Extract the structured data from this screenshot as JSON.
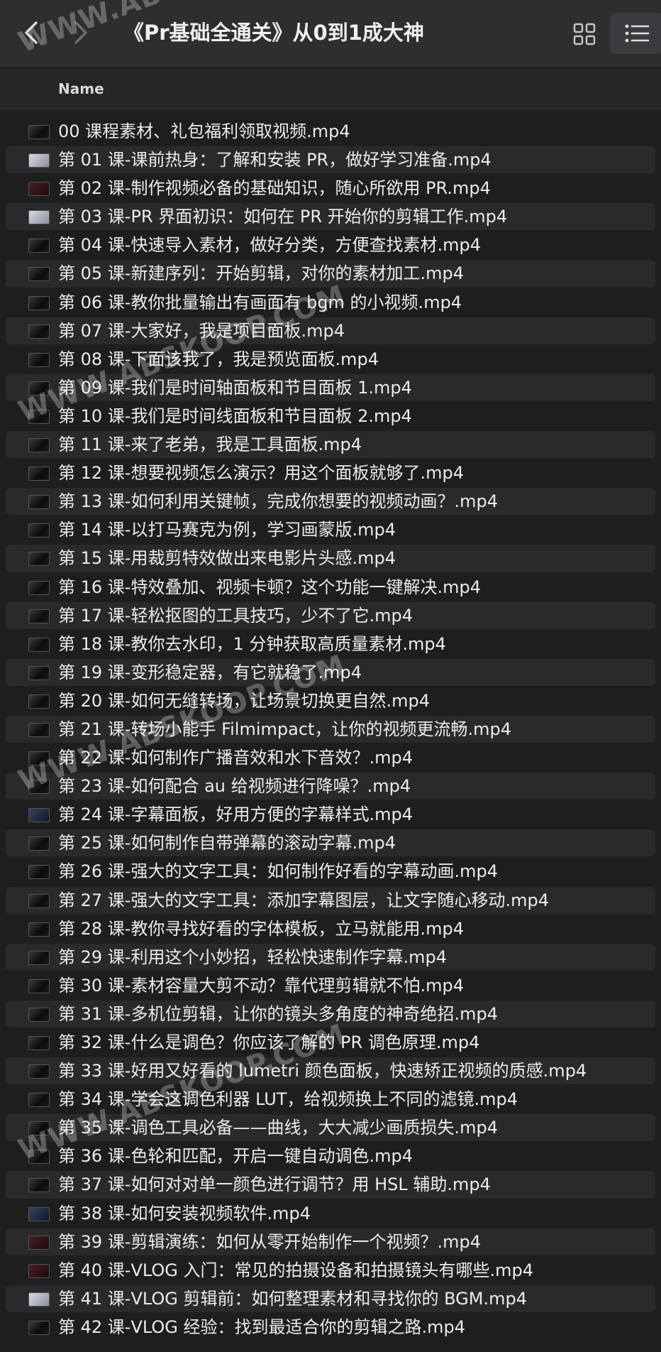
{
  "toolbar": {
    "title": "《Pr基础全通关》从0到1成大神",
    "back_icon": "chevron-left-icon",
    "forward_icon": "chevron-right-icon",
    "grid_view_icon": "grid-view-icon",
    "list_view_icon": "list-view-icon"
  },
  "column_header": {
    "name_label": "Name"
  },
  "watermark": {
    "text": "WWW.ABSKOOP.COM"
  },
  "files": [
    {
      "name": "00 课程素材、礼包福利领取视频.mp4",
      "thumb": "video"
    },
    {
      "name": "第 01 课-课前热身：了解和安装 PR，做好学习准备.mp4",
      "thumb": "light"
    },
    {
      "name": "第 02 课-制作视频必备的基础知识，随心所欲用 PR.mp4",
      "thumb": "red"
    },
    {
      "name": "第 03 课-PR 界面初识：如何在 PR 开始你的剪辑工作.mp4",
      "thumb": "light"
    },
    {
      "name": "第 04 课-快速导入素材，做好分类，方便查找素材.mp4",
      "thumb": "video"
    },
    {
      "name": "第 05 课-新建序列：开始剪辑，对你的素材加工.mp4",
      "thumb": "video"
    },
    {
      "name": "第 06 课-教你批量输出有画面有 bgm 的小视频.mp4",
      "thumb": "video"
    },
    {
      "name": "第 07 课-大家好，我是项目面板.mp4",
      "thumb": "video"
    },
    {
      "name": "第 08 课-下面该我了，我是预览面板.mp4",
      "thumb": "video"
    },
    {
      "name": "第 09 课-我们是时间轴面板和节目面板 1.mp4",
      "thumb": "video"
    },
    {
      "name": "第 10 课-我们是时间线面板和节目面板 2.mp4",
      "thumb": "video"
    },
    {
      "name": "第 11 课-来了老弟，我是工具面板.mp4",
      "thumb": "video"
    },
    {
      "name": "第 12 课-想要视频怎么演示？用这个面板就够了.mp4",
      "thumb": "video"
    },
    {
      "name": "第 13 课-如何利用关键帧，完成你想要的视频动画？.mp4",
      "thumb": "video"
    },
    {
      "name": "第 14 课-以打马赛克为例，学习画蒙版.mp4",
      "thumb": "video"
    },
    {
      "name": "第 15 课-用裁剪特效做出来电影片头感.mp4",
      "thumb": "video"
    },
    {
      "name": "第 16 课-特效叠加、视频卡顿？这个功能一键解决.mp4",
      "thumb": "video"
    },
    {
      "name": "第 17 课-轻松抠图的工具技巧，少不了它.mp4",
      "thumb": "video"
    },
    {
      "name": "第 18 课-教你去水印，1 分钟获取高质量素材.mp4",
      "thumb": "video"
    },
    {
      "name": "第 19 课-变形稳定器，有它就稳了.mp4",
      "thumb": "video"
    },
    {
      "name": "第 20 课-如何无缝转场，让场景切换更自然.mp4",
      "thumb": "video"
    },
    {
      "name": "第 21 课-转场小能手 Filmimpact，让你的视频更流畅.mp4",
      "thumb": "video"
    },
    {
      "name": "第 22 课-如何制作广播音效和水下音效？.mp4",
      "thumb": "video"
    },
    {
      "name": "第 23 课-如何配合 au 给视频进行降噪？.mp4",
      "thumb": "video"
    },
    {
      "name": "第 24 课-字幕面板，好用方便的字幕样式.mp4",
      "thumb": "blue"
    },
    {
      "name": "第 25 课-如何制作自带弹幕的滚动字幕.mp4",
      "thumb": "video"
    },
    {
      "name": "第 26 课-强大的文字工具：如何制作好看的字幕动画.mp4",
      "thumb": "video"
    },
    {
      "name": "第 27 课-强大的文字工具：添加字幕图层，让文字随心移动.mp4",
      "thumb": "video"
    },
    {
      "name": "第 28 课-教你寻找好看的字体模板，立马就能用.mp4",
      "thumb": "video"
    },
    {
      "name": "第 29 课-利用这个小妙招，轻松快速制作字幕.mp4",
      "thumb": "video"
    },
    {
      "name": "第 30 课-素材容量大剪不动？靠代理剪辑就不怕.mp4",
      "thumb": "video"
    },
    {
      "name": "第 31 课-多机位剪辑，让你的镜头多角度的神奇绝招.mp4",
      "thumb": "video"
    },
    {
      "name": "第 32 课-什么是调色？你应该了解的 PR 调色原理.mp4",
      "thumb": "video"
    },
    {
      "name": "第 33 课-好用又好看的 lumetri 颜色面板，快速矫正视频的质感.mp4",
      "thumb": "video"
    },
    {
      "name": "第 34 课-学会这调色利器 LUT，给视频换上不同的滤镜.mp4",
      "thumb": "video"
    },
    {
      "name": "第 35 课-调色工具必备——曲线，大大减少画质损失.mp4",
      "thumb": "video"
    },
    {
      "name": "第 36 课-色轮和匹配，开启一键自动调色.mp4",
      "thumb": "video"
    },
    {
      "name": "第 37 课-如何对对单一颜色进行调节？用 HSL 辅助.mp4",
      "thumb": "video"
    },
    {
      "name": "第 38 课-如何安装视频软件.mp4",
      "thumb": "blue"
    },
    {
      "name": "第 39 课-剪辑演练：如何从零开始制作一个视频？.mp4",
      "thumb": "red"
    },
    {
      "name": "第 40 课-VLOG 入门：常见的拍摄设备和拍摄镜头有哪些.mp4",
      "thumb": "red"
    },
    {
      "name": "第 41 课-VLOG 剪辑前：如何整理素材和寻找你的 BGM.mp4",
      "thumb": "light"
    },
    {
      "name": "第 42 课-VLOG 经验：找到最适合你的剪辑之路.mp4",
      "thumb": "video"
    }
  ]
}
